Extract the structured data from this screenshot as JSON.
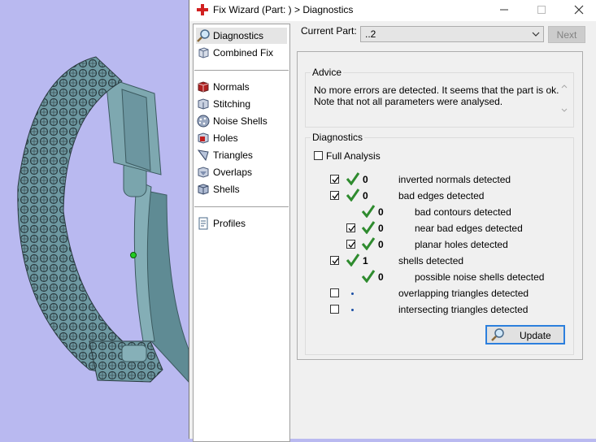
{
  "window": {
    "title": "Fix Wizard (Part: ) > Diagnostics",
    "icon": "red-cross-icon",
    "controls": [
      "minimize-icon",
      "maximize-icon",
      "close-icon"
    ]
  },
  "nav": {
    "items": [
      {
        "label": "Diagnostics",
        "icon": "magnifier-icon",
        "selected": true
      },
      {
        "label": "Combined Fix",
        "icon": "cube-icon"
      },
      {
        "label": "Normals",
        "icon": "normals-icon"
      },
      {
        "label": "Stitching",
        "icon": "stitching-icon"
      },
      {
        "label": "Noise Shells",
        "icon": "noise-shells-icon"
      },
      {
        "label": "Holes",
        "icon": "holes-icon"
      },
      {
        "label": "Triangles",
        "icon": "triangles-icon"
      },
      {
        "label": "Overlaps",
        "icon": "overlaps-icon"
      },
      {
        "label": "Shells",
        "icon": "shells-icon"
      },
      {
        "label": "Profiles",
        "icon": "profiles-icon"
      }
    ]
  },
  "current_part": {
    "label": "Current Part:",
    "value": "..2"
  },
  "next_label": "Next",
  "advice": {
    "title": "Advice",
    "line1": "No more errors are detected. It seems that the part is ok.",
    "line2": "Note that not all parameters were analysed."
  },
  "diagnostics": {
    "title": "Diagnostics",
    "full_analysis": {
      "label": "Full Analysis",
      "checked": false
    },
    "rows": [
      {
        "checkbox": true,
        "checked": true,
        "status": "ok",
        "count": "0",
        "label": "inverted normals detected",
        "indent": 0
      },
      {
        "checkbox": true,
        "checked": true,
        "status": "ok",
        "count": "0",
        "label": "bad edges detected",
        "indent": 0
      },
      {
        "checkbox": false,
        "status": "ok",
        "count": "0",
        "label": "bad contours detected",
        "indent": 1
      },
      {
        "checkbox": true,
        "checked": true,
        "status": "ok",
        "count": "0",
        "label": "near bad edges detected",
        "indent": 1
      },
      {
        "checkbox": true,
        "checked": true,
        "status": "ok",
        "count": "0",
        "label": "planar holes detected",
        "indent": 1
      },
      {
        "checkbox": true,
        "checked": true,
        "status": "ok",
        "count": "1",
        "label": "shells detected",
        "indent": 0
      },
      {
        "checkbox": false,
        "status": "ok",
        "count": "0",
        "label": "possible noise shells detected",
        "indent": 1
      },
      {
        "checkbox": true,
        "checked": false,
        "status": "pending",
        "count": "",
        "label": "overlapping triangles detected",
        "indent": 0
      },
      {
        "checkbox": true,
        "checked": false,
        "status": "pending",
        "count": "",
        "label": "intersecting triangles detected",
        "indent": 0
      }
    ]
  },
  "update_label": "Update",
  "colors": {
    "viewport_bg": "#b9b9f0",
    "model": "#6f9aa3",
    "check_green": "#2e8b2e",
    "accent_blue": "#2c7fdd"
  }
}
